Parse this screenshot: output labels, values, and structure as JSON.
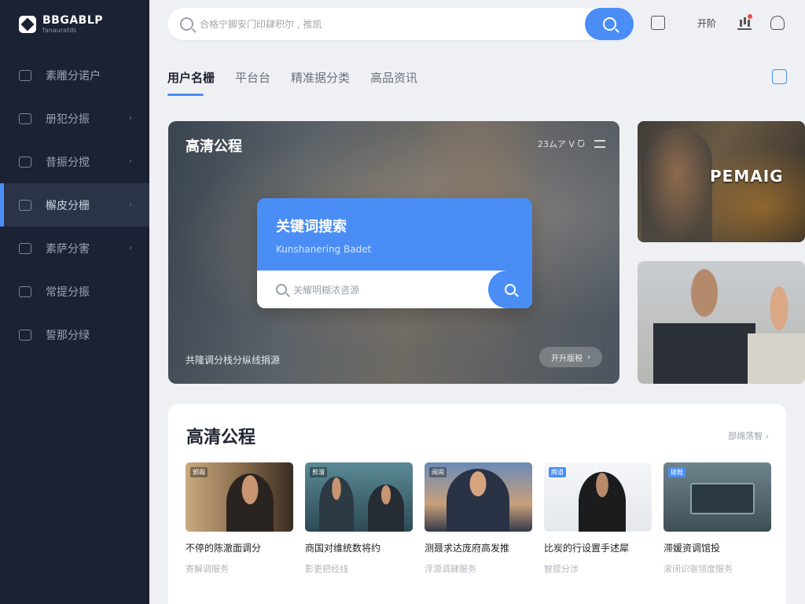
{
  "brand": {
    "title": "BBGABLP",
    "subtitle": "fanauratds"
  },
  "sidebar": {
    "items": [
      {
        "label": "素雕分诺户",
        "icon": "home-icon",
        "chevron": ""
      },
      {
        "label": "册犯分振",
        "icon": "folder-icon",
        "chevron": "›"
      },
      {
        "label": "昔振分搅",
        "icon": "grid-icon",
        "chevron": "›"
      },
      {
        "label": "檞皮分栅",
        "icon": "cube-icon",
        "chevron": "›"
      },
      {
        "label": "素萨分害",
        "icon": "chat-icon",
        "chevron": "›"
      },
      {
        "label": "常提分振",
        "icon": "users-icon",
        "chevron": ""
      },
      {
        "label": "誓那分绿",
        "icon": "book-icon",
        "chevron": ""
      }
    ]
  },
  "search": {
    "placeholder": "合格宁脚安门印肆积尔 , 推凯"
  },
  "topbar": {
    "user_label": "开阶"
  },
  "tabs": [
    {
      "label": "用户名栅"
    },
    {
      "label": "平台台"
    },
    {
      "label": "精准据分类"
    },
    {
      "label": "高品资讯"
    }
  ],
  "hero": {
    "title": "高清公程",
    "meta": "23ムア V Ⴀ",
    "caption": "共隆调分栈分纵线捐源",
    "pill_label": "开升版税"
  },
  "keyword_card": {
    "title": "关键词搜索",
    "subtitle": "Kunshanering Badet",
    "placeholder": "关耀明糊浓咨源"
  },
  "side_thumbs": [
    {
      "label": "PEMAIG"
    }
  ],
  "panel": {
    "title": "高清公程",
    "more": "部绵荡智 ›",
    "cards": [
      {
        "tag": "郭阁",
        "title": "不停的陈澈面调分",
        "sub": "寄解调服务",
        "tag_style": "dark"
      },
      {
        "tag": "剪溜",
        "title": "商国对维统数将约",
        "sub": "影更把经线",
        "tag_style": "dark"
      },
      {
        "tag": "阅闹",
        "title": "测聂求达庞府高发推",
        "sub": "浮源调肆服务",
        "tag_style": "dark"
      },
      {
        "tag": "腾道",
        "title": "比炭的行设置手述犀",
        "sub": "智提分涉",
        "tag_style": "blue"
      },
      {
        "tag": "拨鞋",
        "title": "滞媛资调馆投",
        "sub": "滚闭识驱领度服务",
        "tag_style": "blue"
      }
    ]
  },
  "colors": {
    "accent": "#4a8ef5",
    "sidebar_bg": "#1b2233",
    "page_bg": "#eef0f4"
  }
}
